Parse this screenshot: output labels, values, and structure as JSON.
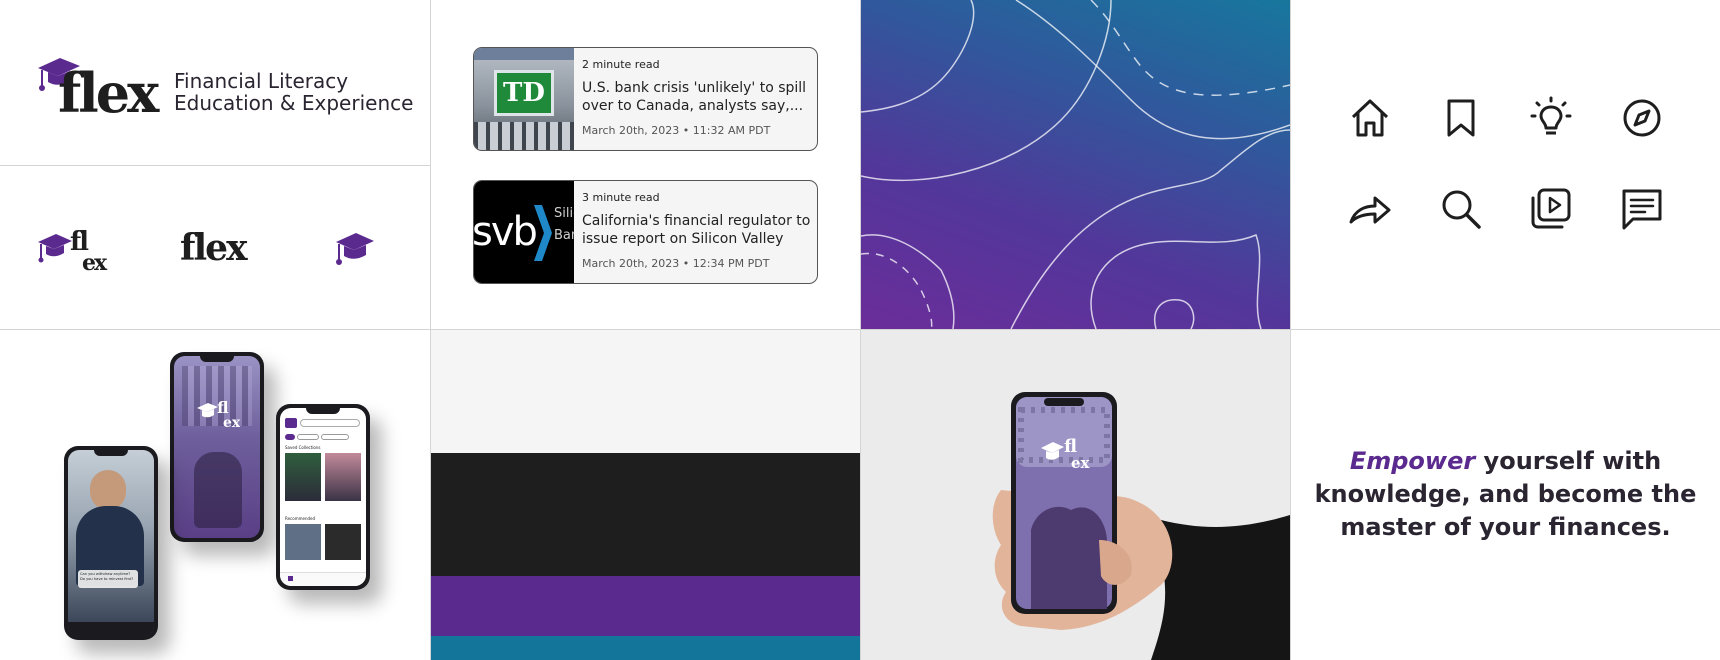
{
  "brand": {
    "wordmark": "flex",
    "tagline_line1": "Financial Literacy",
    "tagline_line2": "Education & Experience",
    "colors": {
      "purple": "#5b2a8f",
      "dark": "#1e1e1e",
      "teal": "#137599",
      "light": "#f5f5f5",
      "ink": "#2a2530"
    }
  },
  "variants": {
    "stacked": "fl",
    "stacked_bottom": "ex",
    "wordmark": "flex"
  },
  "news": [
    {
      "read_time": "2 minute read",
      "headline": "U.S. bank crisis 'unlikely' to spill over to Canada, analysts say,...",
      "date": "March 20th, 2023 • 11:32 AM PDT",
      "thumb_text": "TD"
    },
    {
      "read_time": "3 minute read",
      "headline": "California's financial regulator to issue report on Silicon Valley Ban...",
      "date": "March 20th, 2023 • 12:34 PM PDT",
      "thumb_text": "svb",
      "thumb_side": "Silic Ban"
    }
  ],
  "icons": [
    "home-icon",
    "bookmark-icon",
    "lightbulb-icon",
    "compass-icon",
    "share-icon",
    "search-icon",
    "video-library-icon",
    "chat-icon"
  ],
  "palette": [
    "#f5f5f5",
    "#1e1e1e",
    "#5b2a8f",
    "#137599"
  ],
  "phones": {
    "splash_logo_top": "fl",
    "splash_logo_bottom": "ex",
    "video_caption": "Can you withdraw anytime? Do you have to reinvest first?",
    "section_saved": "Saved Collections",
    "section_recommended": "Recommended"
  },
  "slogan": {
    "emphasis": "Empower",
    "rest": " yourself with knowledge, and become the master of your finances."
  }
}
